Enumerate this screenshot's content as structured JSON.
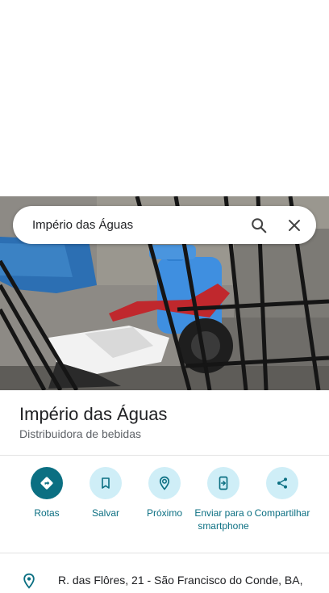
{
  "search": {
    "query": "Império das Águas"
  },
  "place": {
    "name": "Império das Águas",
    "category": "Distribuidora de bebidas",
    "address": "R. das Flôres, 21 - São Francisco do Conde, BA,"
  },
  "actions": [
    {
      "label": "Rotas",
      "icon": "directions-icon"
    },
    {
      "label": "Salvar",
      "icon": "bookmark-icon"
    },
    {
      "label": "Próximo",
      "icon": "nearby-icon"
    },
    {
      "label": "Enviar para o smartphone",
      "icon": "send-to-phone-icon"
    },
    {
      "label": "Compartilhar",
      "icon": "share-icon"
    }
  ],
  "colors": {
    "accent": "#0b6f82",
    "action_bg": "#cfeef7"
  }
}
